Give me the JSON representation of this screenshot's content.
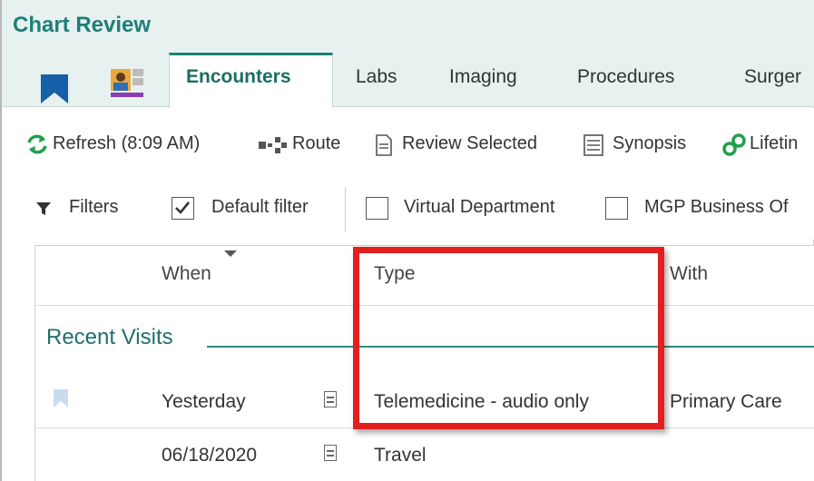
{
  "window": {
    "title": "Chart Review"
  },
  "tabs": [
    {
      "label": "Encounters",
      "active": true
    },
    {
      "label": "Labs"
    },
    {
      "label": "Imaging"
    },
    {
      "label": "Procedures"
    },
    {
      "label": "Surger"
    }
  ],
  "toolbar": {
    "refresh_label": "Refresh (8:09 AM)",
    "route_label": "Route",
    "review_selected_label": "Review Selected",
    "synopsis_label": "Synopsis",
    "lifetime_label": "Lifetin"
  },
  "filters": {
    "filters_label": "Filters",
    "default_filter_label": "Default filter",
    "default_filter_checked": true,
    "virtual_department_label": "Virtual Department",
    "mgp_business_label": "MGP Business Of"
  },
  "grid": {
    "columns": [
      "When",
      "Type",
      "With"
    ],
    "section_title": "Recent Visits",
    "rows": [
      {
        "when": "Yesterday",
        "type": "Telemedicine - audio only",
        "with": "Primary Care"
      },
      {
        "when": "06/18/2020",
        "type": "Travel",
        "with": ""
      }
    ]
  },
  "colors": {
    "accent": "#1f7e79",
    "header_bg": "#e6f1f0",
    "highlight": "#e31e1e",
    "bookmark_blue": "#1660a8"
  }
}
